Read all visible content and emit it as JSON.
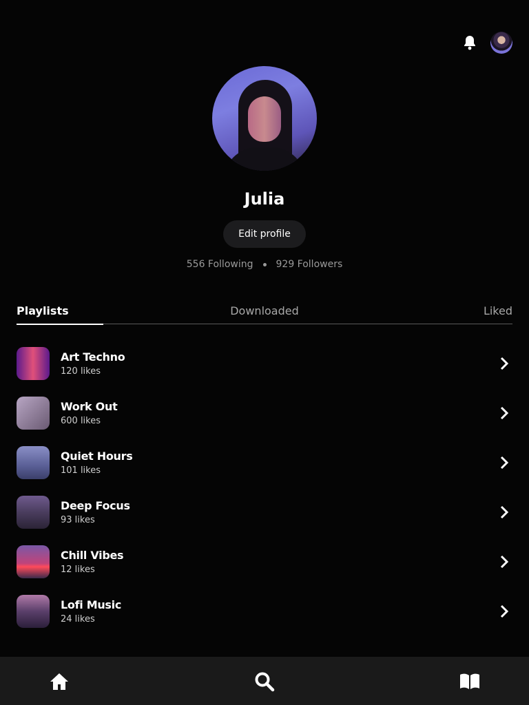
{
  "header": {
    "notification_icon": "bell-icon",
    "avatar_icon": "user-avatar"
  },
  "profile": {
    "name": "Julia",
    "edit_label": "Edit profile",
    "following": "556 Following",
    "followers": "929 Followers"
  },
  "tabs": [
    {
      "label": "Playlists",
      "active": true
    },
    {
      "label": "Downloaded",
      "active": false
    },
    {
      "label": "Liked",
      "active": false
    }
  ],
  "playlists": [
    {
      "title": "Art Techno",
      "likes": "120 likes",
      "colors": [
        "#5b1a8c",
        "#e0507a"
      ]
    },
    {
      "title": "Work Out",
      "likes": "600 likes",
      "colors": [
        "#b8a6c4",
        "#6a5a72"
      ]
    },
    {
      "title": "Quiet Hours",
      "likes": "101 likes",
      "colors": [
        "#8a8fc6",
        "#3b3f6a"
      ]
    },
    {
      "title": "Deep Focus",
      "likes": "93 likes",
      "colors": [
        "#6f5a8e",
        "#2b2336"
      ]
    },
    {
      "title": "Chill Vibes",
      "likes": "12 likes",
      "colors": [
        "#7a58a6",
        "#ff4a5a"
      ]
    },
    {
      "title": "Lofi Music",
      "likes": "24 likes",
      "colors": [
        "#2b1f3a",
        "#b07aa8"
      ]
    }
  ],
  "nav": {
    "home_icon": "home-icon",
    "search_icon": "search-icon",
    "library_icon": "book-icon"
  }
}
